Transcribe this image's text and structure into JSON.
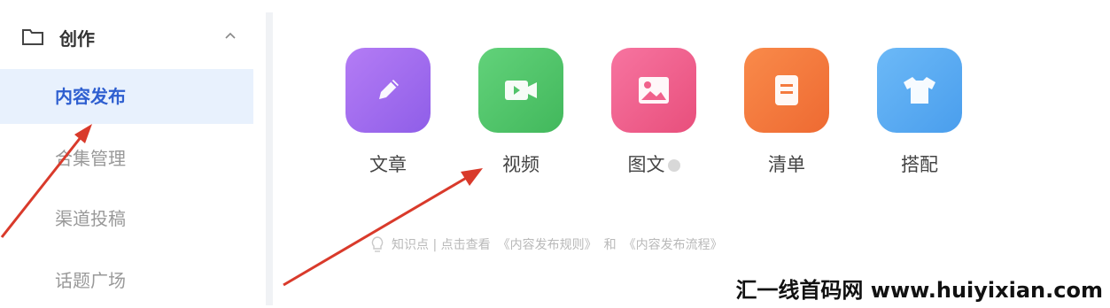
{
  "sidebar": {
    "section_title": "创作",
    "items": [
      {
        "label": "内容发布",
        "active": true
      },
      {
        "label": "合集管理",
        "active": false
      },
      {
        "label": "渠道投稿",
        "active": false
      },
      {
        "label": "话题广场",
        "active": false
      }
    ]
  },
  "main": {
    "tiles": [
      {
        "label": "文章",
        "icon": "pencil-icon",
        "color": "#a06af0"
      },
      {
        "label": "视频",
        "icon": "video-icon",
        "color": "#52c46a"
      },
      {
        "label": "图文",
        "icon": "image-icon",
        "color": "#f0618c"
      },
      {
        "label": "清单",
        "icon": "list-icon",
        "color": "#f47a3e"
      },
      {
        "label": "搭配",
        "icon": "shirt-icon",
        "color": "#59acf2"
      }
    ],
    "tip": {
      "prefix": "知识点 | 点击查看",
      "rules_link": "《内容发布规则》",
      "conjunction": "和",
      "process_link": "《内容发布流程》"
    }
  },
  "watermark": "汇一线首码网 www.huiyixian.com",
  "colors": {
    "accent": "#2e5fd0",
    "arrow": "#d93a2b"
  }
}
